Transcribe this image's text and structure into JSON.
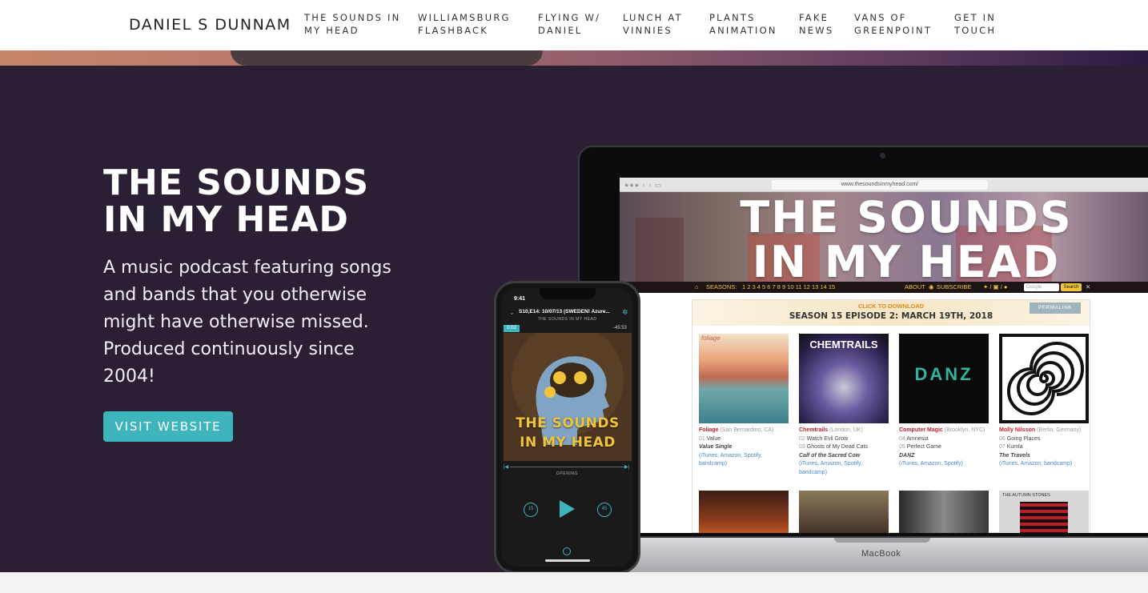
{
  "nav": {
    "brand": "DANIEL S DUNNAM",
    "links": [
      {
        "line1": "THE SOUNDS IN",
        "line2": "MY HEAD"
      },
      {
        "line1": "WILLIAMSBURG",
        "line2": "FLASHBACK"
      },
      {
        "line1": "FLYING W/",
        "line2": "DANIEL"
      },
      {
        "line1": "LUNCH AT",
        "line2": "VINNIES"
      },
      {
        "line1": "PLANTS",
        "line2": "ANIMATION"
      },
      {
        "line1": "FAKE",
        "line2": "NEWS"
      },
      {
        "line1": "VANS OF",
        "line2": "GREENPOINT"
      },
      {
        "line1": "GET IN",
        "line2": "TOUCH"
      }
    ]
  },
  "hero": {
    "title_line1": "THE SOUNDS",
    "title_line2": "IN MY HEAD",
    "description": "A music podcast featuring songs and bands that you otherwise might have otherwise missed. Produced continuously since 2004!",
    "button_label": "VISIT WEBSITE",
    "accent_color": "#3eb5bd",
    "background_color": "#2b1f33"
  },
  "laptop": {
    "url": "www.thesoundsinmyhead.com/",
    "site_logo_line1": "THE SOUNDS",
    "site_logo_line2": "IN MY HEAD",
    "site_nav": {
      "seasons_label": "SEASONS:",
      "season_numbers": "1  2  3  4  5  6  7  8  9  10  11  12  13  14  15",
      "about": "ABOUT",
      "subscribe": "SUBSCRIBE",
      "search_placeholder": "Google",
      "search_button": "Search"
    },
    "click_to_download": "CLICK TO DOWNLOAD",
    "episode_title": "SEASON 15 EPISODE 2: MARCH 19TH, 2018",
    "permalink": "PERMALINK",
    "albums": [
      {
        "artist": "Foliage",
        "location": "(San Bernardino, CA)",
        "track1_num": "01",
        "track1": "Value",
        "track2_num": "",
        "track2": "",
        "album": "Value Single",
        "links": "(iTunes, Amazon, Spotify, bandcamp)",
        "cover_text": "foliage"
      },
      {
        "artist": "Chemtrails",
        "location": "(London, UK)",
        "track1_num": "02",
        "track1": "Watch Evil Grow",
        "track2_num": "03",
        "track2": "Ghosts of My Dead Cats",
        "album": "Calf of the Sacred Cow",
        "links": "(iTunes, Amazon, Spotify, bandcamp)",
        "cover_text": "CHEMTRAILS"
      },
      {
        "artist": "Computer Magic",
        "location": "(Brooklyn, NYC)",
        "track1_num": "04",
        "track1": "Amnesia",
        "track2_num": "05",
        "track2": "Perfect Game",
        "album": "DANZ",
        "links": "(iTunes, Amazon, Spotify)",
        "cover_text": "DANZ"
      },
      {
        "artist": "Molly Nilsson",
        "location": "(Berlin, Germany)",
        "track1_num": "06",
        "track1": "Going Places",
        "track2_num": "07",
        "track2": "Kumla",
        "album": "The Travels",
        "links": "(iTunes, Amazon, bandcamp)",
        "cover_text": ""
      }
    ],
    "row2_cover4_text": "THE AUTUMN STONES",
    "base_label": "MacBook"
  },
  "phone": {
    "time": "9:41",
    "episode": "S10,E14: 10/07/13 (SWEDEN! Azure...",
    "show": "THE SOUNDS IN MY HEAD",
    "elapsed": "0:02",
    "remaining": "-45:53",
    "artwork_line1": "THE SOUNDS",
    "artwork_line2": "IN MY HEAD",
    "chapter": "OPENING",
    "rewind": "15",
    "forward": "45"
  }
}
